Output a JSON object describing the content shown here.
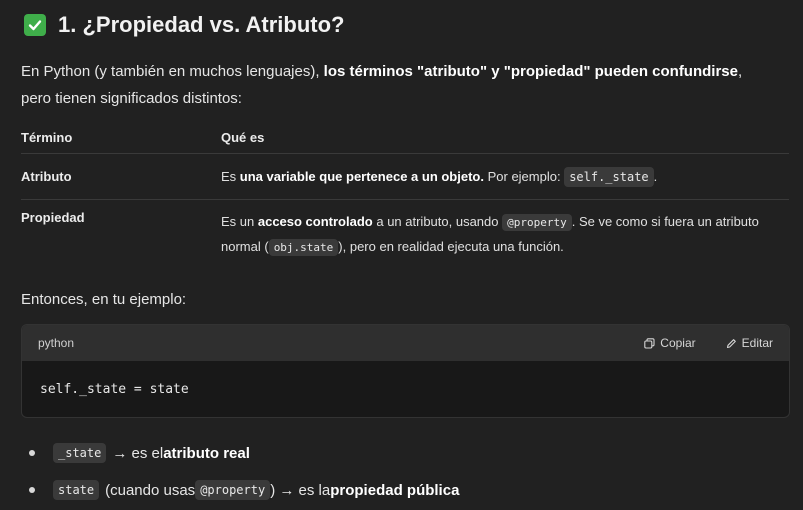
{
  "heading": {
    "number": "1.",
    "text": "¿Propiedad vs. Atributo?"
  },
  "intro": {
    "pre": "En Python (y también en muchos lenguajes), ",
    "bold": "los términos \"atributo\" y \"propiedad\" pueden confundirse",
    "post": ",",
    "line2": "pero tienen significados distintos:"
  },
  "table": {
    "headers": [
      "Término",
      "Qué es"
    ],
    "row1": {
      "term": "Atributo",
      "pre": "Es ",
      "bold": "una variable que pertenece a un objeto.",
      "mid": " Por ejemplo: ",
      "code": "self._state",
      "post": "."
    },
    "row2": {
      "term": "Propiedad",
      "pre": "Es un ",
      "bold": "acceso controlado",
      "mid": " a un atributo, usando ",
      "code": "@property",
      "mid2": ". Se ve como si fuera un atributo",
      "line2_pre": "normal (",
      "code2": "obj.state",
      "line2_post": "), pero en realidad ejecuta una función."
    }
  },
  "then_text": "Entonces, en tu ejemplo:",
  "codeblock": {
    "language": "python",
    "copy_label": "Copiar",
    "edit_label": "Editar",
    "code": "self._state = state"
  },
  "bullets": {
    "b1": {
      "code": "_state",
      "pre": "→ es el ",
      "bold": "atributo real"
    },
    "b2": {
      "code": "state",
      "pre": "(cuando usas ",
      "code2": "@property",
      "mid": ") → es la ",
      "bold": "propiedad pública"
    }
  },
  "colors": {
    "background": "#212121",
    "check": "#3fae4a",
    "code_bg": "#181818",
    "code_header": "#2f2f2f"
  }
}
